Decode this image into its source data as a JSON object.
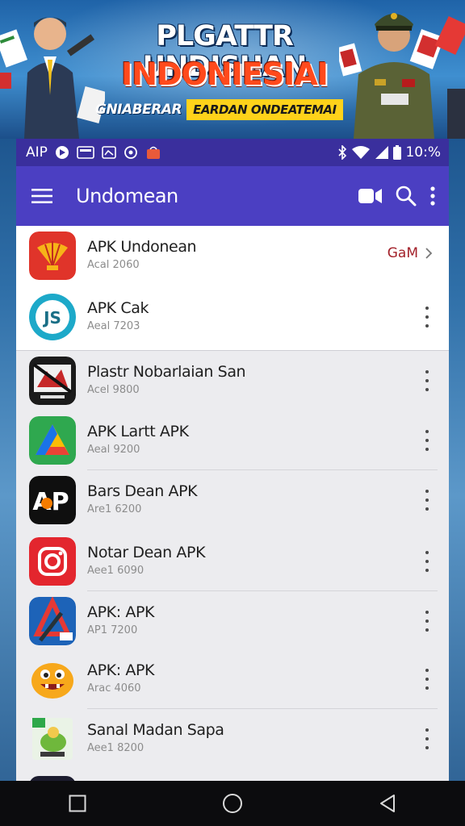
{
  "banner": {
    "title_line1": "PLGATTR UNDISHAN",
    "title_line2": "INDONIESIAI",
    "tagline_left": "GNIABERAR",
    "tagline_right": "EARDAN ONDEATEMAI"
  },
  "status_bar": {
    "carrier": "AIP",
    "time": "10:%"
  },
  "app_bar": {
    "title": "Undomean",
    "icons": [
      "menu-icon",
      "video-icon",
      "search-icon",
      "more-vert-icon"
    ]
  },
  "apps": [
    {
      "name": "APK Undonean",
      "subtitle": "Acal 2060",
      "action_label": "GaM",
      "icon": "shell-logo-icon"
    },
    {
      "name": "APK Cak",
      "subtitle": "Aeal 7203",
      "icon": "teal-badge-icon"
    },
    {
      "name": "Plastr Nobarlaian San",
      "subtitle": "Acel 9800",
      "icon": "poster-icon"
    },
    {
      "name": "APK Lartt APK",
      "subtitle": "Aeal 9200",
      "icon": "triangle-logo-icon"
    },
    {
      "name": "Bars Dean APK",
      "subtitle": "Are1 6200",
      "icon": "ap-logo-icon"
    },
    {
      "name": "Notar Dean APK",
      "subtitle": "Aee1 6090",
      "icon": "camera-logo-icon"
    },
    {
      "name": "APK: APK",
      "subtitle": "AP1 7200",
      "icon": "knife-logo-icon"
    },
    {
      "name": "APK: APK",
      "subtitle": "Arac 4060",
      "icon": "monster-icon"
    },
    {
      "name": "Sanal Madan Sapa",
      "subtitle": "Aee1 8200",
      "icon": "turtle-icon"
    }
  ],
  "nav": [
    "recents-icon",
    "home-icon",
    "back-icon"
  ]
}
